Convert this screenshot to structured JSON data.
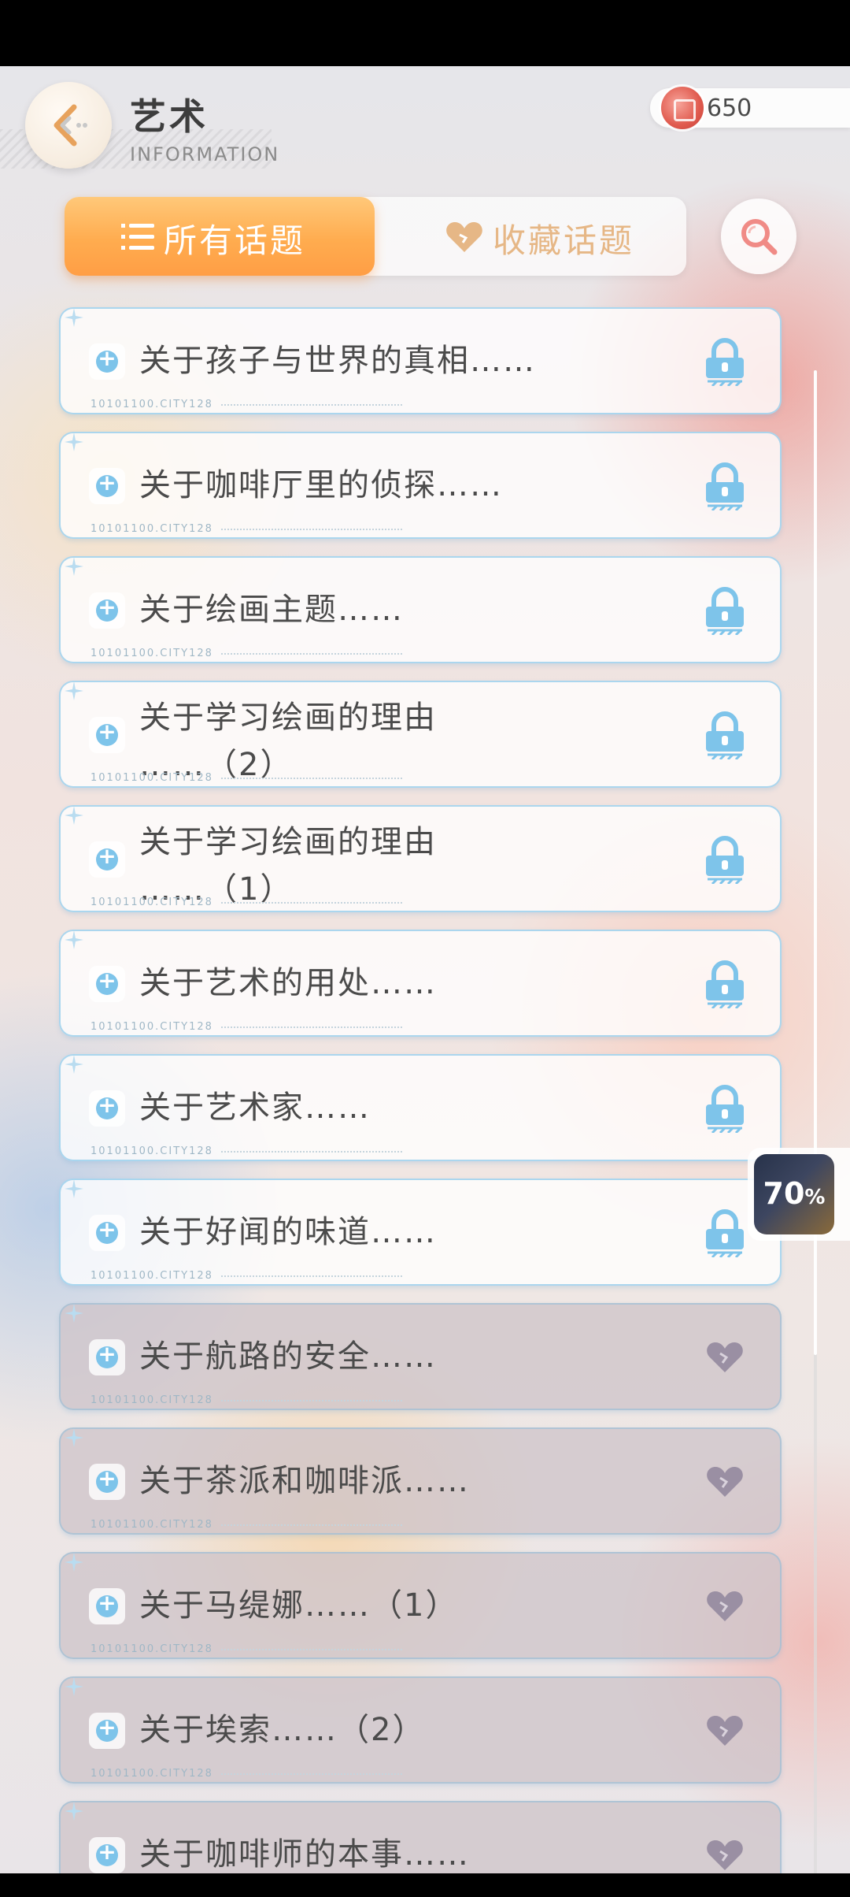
{
  "header": {
    "title": "艺术",
    "subtitle": "INFORMATION",
    "currency_value": "650"
  },
  "tabs": {
    "all_label": "所有话题",
    "favorites_label": "收藏话题"
  },
  "list": {
    "code_text": "10101100.CITY128",
    "items": [
      {
        "label": "关于孩子与世界的真相……",
        "state": "locked"
      },
      {
        "label": "关于咖啡厅里的侦探……",
        "state": "locked"
      },
      {
        "label": "关于绘画主题……",
        "state": "locked"
      },
      {
        "label_line1": "关于学习绘画的理由",
        "label_line2": "……（2）",
        "state": "locked"
      },
      {
        "label_line1": "关于学习绘画的理由",
        "label_line2": "……（1）",
        "state": "locked"
      },
      {
        "label": "关于艺术的用处……",
        "state": "locked"
      },
      {
        "label": "关于艺术家……",
        "state": "locked"
      },
      {
        "label": "关于好闻的味道……",
        "state": "locked"
      },
      {
        "label": "关于航路的安全……",
        "state": "favorite"
      },
      {
        "label": "关于茶派和咖啡派……",
        "state": "favorite"
      },
      {
        "label": "关于马缇娜……（1）",
        "state": "favorite"
      },
      {
        "label": "关于埃索……（2）",
        "state": "favorite"
      },
      {
        "label": "关于咖啡师的本事……",
        "state": "favorite"
      }
    ]
  },
  "float_widget": {
    "value": "70",
    "unit": "%"
  },
  "colors": {
    "tab_active": "#ffac4f",
    "tab_inactive_text": "#e6b786",
    "lock_icon": "#7ec4ea",
    "heart_icon": "#9a8fa3"
  },
  "icons": {
    "back": "back-arrow-icon",
    "coin": "coin-icon",
    "list": "list-icon",
    "heart": "heart-icon",
    "search": "search-icon",
    "lock": "lock-icon",
    "bullet": "plus-bullet-icon",
    "sparkle": "sparkle-icon"
  }
}
